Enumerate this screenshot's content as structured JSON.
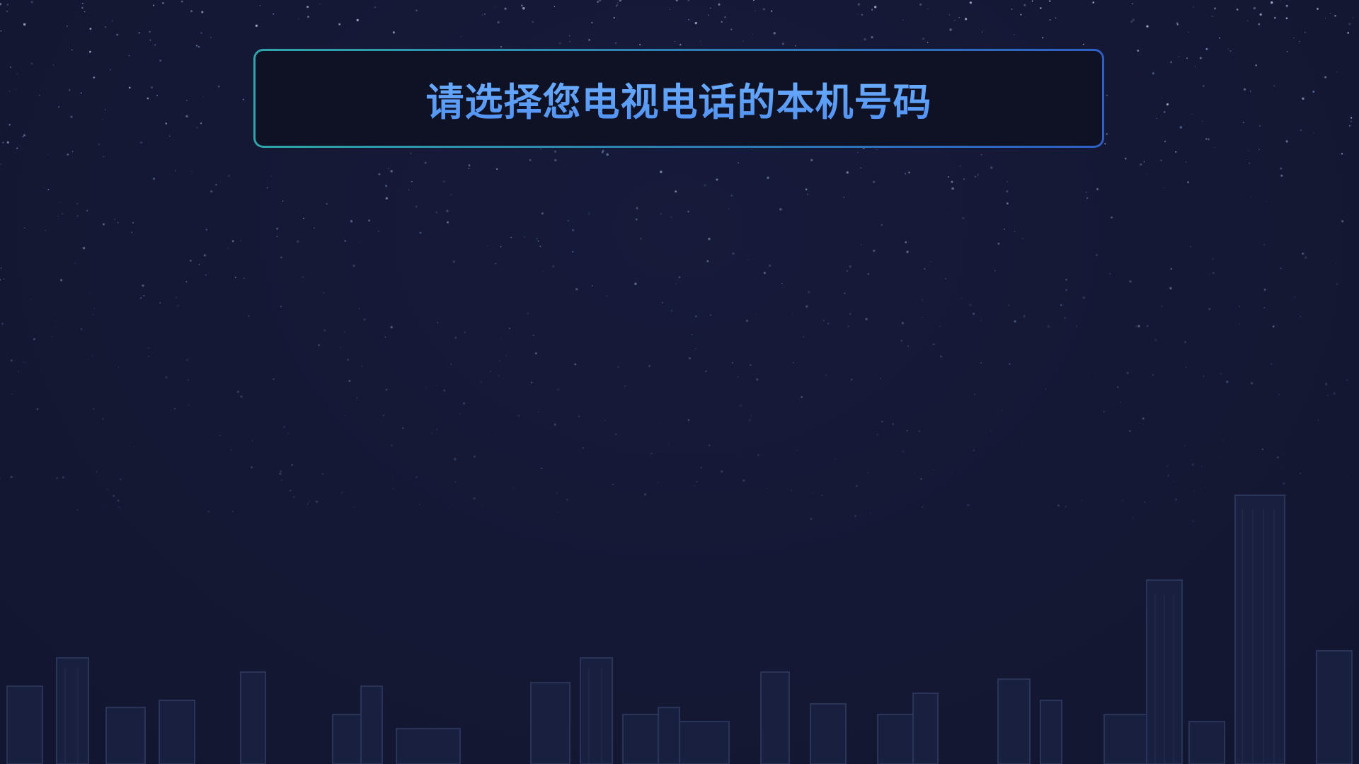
{
  "header": {
    "title": "请选择您电视电话的本机号码"
  },
  "colors": {
    "background": "#141836",
    "panel_background": "#0f1125",
    "panel_border_start": "#2fa5a8",
    "panel_border_end": "#2f5fc4",
    "title_text": "#5a9cf6"
  },
  "decor": {
    "background_image": "starry-sky-city-skyline"
  }
}
